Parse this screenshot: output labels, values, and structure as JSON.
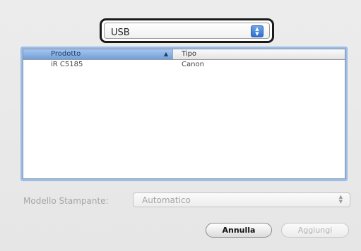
{
  "connection": {
    "selected": "USB"
  },
  "table": {
    "columns": [
      {
        "label": "Prodotto",
        "sorted": true
      },
      {
        "label": "Tipo"
      }
    ],
    "rows": [
      {
        "prodotto": "iR C5185",
        "tipo": "Canon"
      }
    ]
  },
  "model": {
    "label": "Modello Stampante:",
    "value": "Automatico"
  },
  "buttons": {
    "cancel": "Annulla",
    "add": "Aggiungi"
  },
  "colors": {
    "accent": "#6f9fdc",
    "focus_ring": "#9cbde6"
  }
}
